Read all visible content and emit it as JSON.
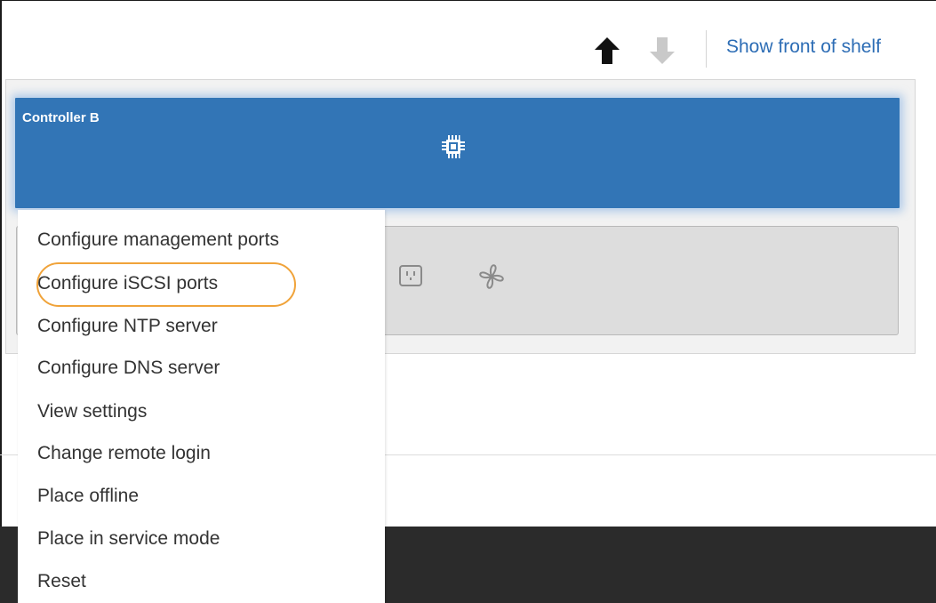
{
  "toolbar": {
    "up_icon": "arrow-up-icon",
    "down_icon": "arrow-down-icon",
    "show_front_label": "Show front of shelf"
  },
  "controller": {
    "title": "Controller B",
    "icon": "chip-icon",
    "color": "#3275b6"
  },
  "tray_icons": [
    "power-outlet-icon",
    "fan-icon"
  ],
  "context_menu": {
    "items": [
      "Configure management ports",
      "Configure iSCSI ports",
      "Configure NTP server",
      "Configure DNS server",
      "View settings",
      "Change remote login",
      "Place offline",
      "Place in service mode",
      "Reset"
    ],
    "highlighted": "Configure iSCSI ports",
    "highlight_color": "#f0a33a"
  },
  "colors": {
    "link": "#2d6db5",
    "band": "#2b2b2b"
  }
}
